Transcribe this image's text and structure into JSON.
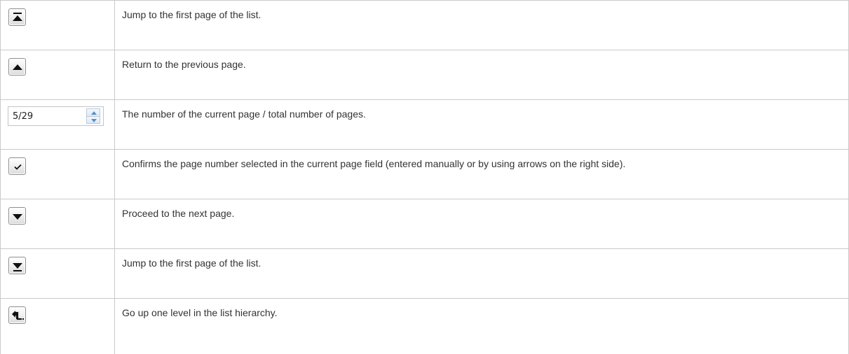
{
  "rows": [
    {
      "icon": "first-page-icon",
      "description": "Jump to the first page of the list."
    },
    {
      "icon": "previous-page-icon",
      "description": "Return to the previous page."
    },
    {
      "icon": "page-spinner",
      "description": "The number of the current page / total number of pages."
    },
    {
      "icon": "confirm-check-icon",
      "description": "Confirms the page number selected in the current page field (entered manually or by using arrows on the right side)."
    },
    {
      "icon": "next-page-icon",
      "description": "Proceed to the next page."
    },
    {
      "icon": "last-page-icon",
      "description": "Jump to the first page of the list."
    },
    {
      "icon": "level-up-icon",
      "description": "Go up one level in the list hierarchy."
    }
  ],
  "page_field": {
    "value": "5/29"
  },
  "colors": {
    "border": "#c9c9c9",
    "text": "#333333",
    "icon": "#111111",
    "spinner_arrow": "#5a8fc8"
  }
}
